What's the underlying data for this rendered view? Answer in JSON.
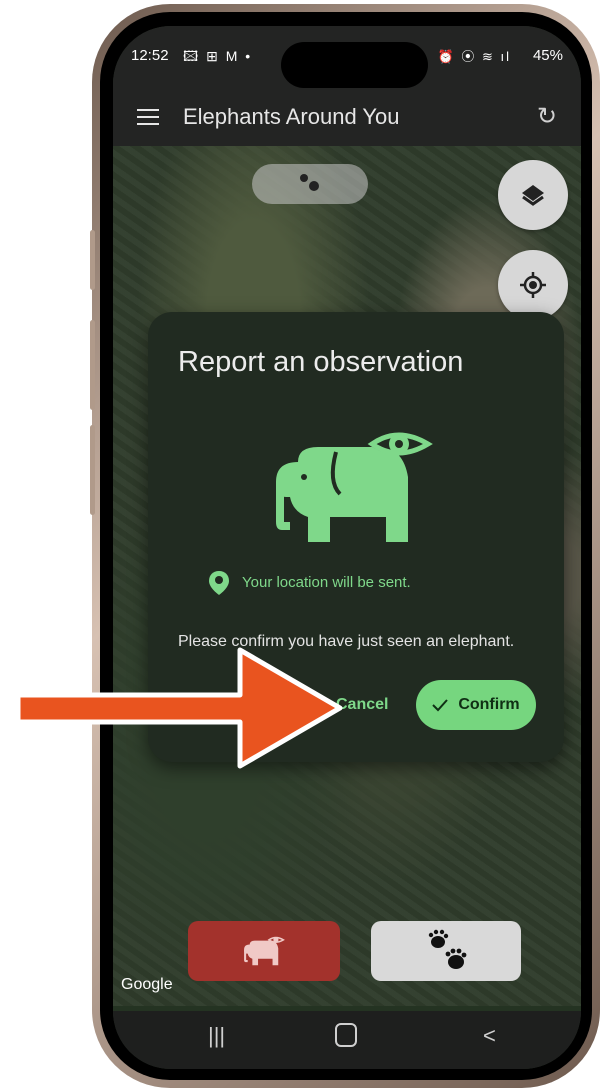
{
  "status_bar": {
    "time": "12:52",
    "left_icons": "🖾 ⊞ M •",
    "right_icons": "⏰ ⦿ ≋ ıl",
    "battery": "45%"
  },
  "app_bar": {
    "title": "Elephants Around You"
  },
  "dialog": {
    "title": "Report an observation",
    "location_note": "Your location will be sent.",
    "message": "Please confirm you have just seen an elephant.",
    "cancel_label": "Cancel",
    "confirm_label": "Confirm"
  },
  "map": {
    "attribution": "Google"
  },
  "colors": {
    "accent_green": "#76d67f",
    "report_red": "#a3322c",
    "arrow_orange": "#e9541f"
  },
  "icons": [
    "menu-icon",
    "refresh-icon",
    "layers-icon",
    "my-location-icon",
    "paw-icon",
    "elephant-eye-icon",
    "location-pin-icon",
    "check-icon",
    "recents-icon",
    "home-icon",
    "back-icon"
  ]
}
